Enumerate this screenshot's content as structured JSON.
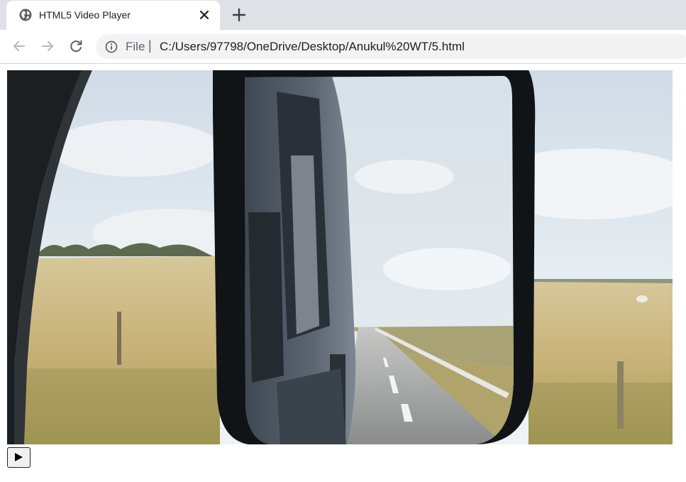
{
  "browser": {
    "tab": {
      "title": "HTML5 Video Player",
      "favicon": "globe-icon",
      "close": "close-icon"
    },
    "new_tab": "plus-icon",
    "nav": {
      "back": "arrow-left-icon",
      "forward": "arrow-right-icon",
      "reload": "reload-icon"
    },
    "address_bar": {
      "info": "info-icon",
      "scheme_label": "File",
      "separator": "|",
      "url": "C:/Users/97798/OneDrive/Desktop/Anukul%20WT/5.html"
    }
  },
  "page": {
    "video": {
      "frame": "side mirror reflecting a van and road, fields in background",
      "controls": {
        "play_icon": "play-icon"
      }
    }
  },
  "colors": {
    "tabstrip_bg": "#dee1e6",
    "omnibox_bg": "#f1f3f4",
    "text": "#202124",
    "icon_grey": "#5f6368"
  }
}
